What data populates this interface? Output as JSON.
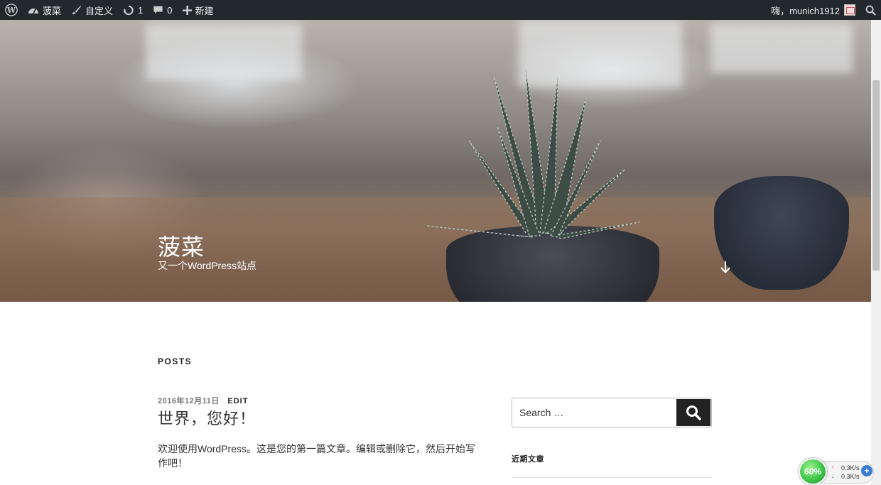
{
  "adminbar": {
    "site_name": "菠菜",
    "customize": "自定义",
    "updates_count": "1",
    "comments_count": "0",
    "new_label": "新建",
    "greeting": "嗨，munich1912"
  },
  "header": {
    "site_title": "菠菜",
    "site_description": "又一个WordPress站点"
  },
  "content": {
    "posts_heading": "POSTS",
    "post": {
      "date": "2016年12月11日",
      "edit_label": "EDIT",
      "title": "世界，您好！",
      "excerpt": "欢迎使用WordPress。这是您的第一篇文章。编辑或删除它，然后开始写作吧！"
    }
  },
  "sidebar": {
    "search_placeholder": "Search …",
    "recent_posts_title": "近期文章"
  },
  "netmonitor": {
    "percent": "60%",
    "upload": "0.3K/s",
    "download": "0.3K/s"
  },
  "colors": {
    "adminbar_bg": "#23282d",
    "search_button_bg": "#222222"
  }
}
